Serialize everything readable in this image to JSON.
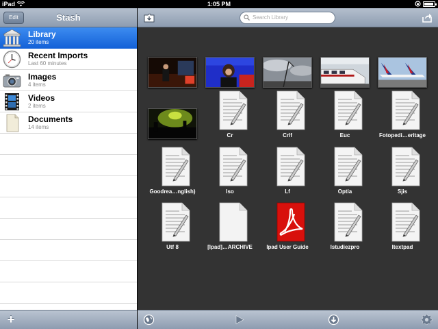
{
  "status_bar": {
    "device": "iPad",
    "time": "1:05 PM"
  },
  "sidebar": {
    "title": "Stash",
    "edit_label": "Edit",
    "add_label": "+",
    "items": [
      {
        "label": "Library",
        "count": "20 items",
        "icon": "library-icon",
        "selected": true
      },
      {
        "label": "Recent Imports",
        "count": "Last 60 minutes",
        "icon": "clock-icon",
        "selected": false
      },
      {
        "label": "Images",
        "count": "4 items",
        "icon": "camera-icon",
        "selected": false
      },
      {
        "label": "Videos",
        "count": "2 items",
        "icon": "film-icon",
        "selected": false
      },
      {
        "label": "Documents",
        "count": "14 items",
        "icon": "document-icon",
        "selected": false
      }
    ]
  },
  "toolbar": {
    "search_placeholder": "Search Library",
    "left_icon": "folder-icon",
    "right_icon": "share-icon"
  },
  "files": [
    {
      "name": "",
      "kind": "photo",
      "thumb": "stage-speaker"
    },
    {
      "name": "",
      "kind": "photo",
      "thumb": "presenter"
    },
    {
      "name": "",
      "kind": "photo",
      "thumb": "cloudy-sky"
    },
    {
      "name": "",
      "kind": "photo",
      "thumb": "train"
    },
    {
      "name": "",
      "kind": "photo",
      "thumb": "airplane"
    },
    {
      "name": "",
      "kind": "video",
      "thumb": "night-city"
    },
    {
      "name": "Cr",
      "kind": "text"
    },
    {
      "name": "Crlf",
      "kind": "text"
    },
    {
      "name": "Euc",
      "kind": "text"
    },
    {
      "name": "Fotopedi…eritage",
      "kind": "text"
    },
    {
      "name": "Goodrea…nglish)",
      "kind": "text"
    },
    {
      "name": "Iso",
      "kind": "text"
    },
    {
      "name": "Lf",
      "kind": "text"
    },
    {
      "name": "Optia",
      "kind": "text"
    },
    {
      "name": "Sjis",
      "kind": "text"
    },
    {
      "name": "Utf 8",
      "kind": "text"
    },
    {
      "name": "[Ipad]…ARCHIVE",
      "kind": "blank"
    },
    {
      "name": "Ipad User Guide",
      "kind": "pdf"
    },
    {
      "name": "Istudiezpro",
      "kind": "text"
    },
    {
      "name": "Itextpad",
      "kind": "text"
    }
  ],
  "bottom_toolbar": {
    "icons": [
      "globe-icon",
      "play-icon",
      "download-icon",
      "gear-icon"
    ]
  },
  "colors": {
    "selection": "#1a6de0",
    "bar": "#a2afc0",
    "content_bg": "#333333"
  }
}
